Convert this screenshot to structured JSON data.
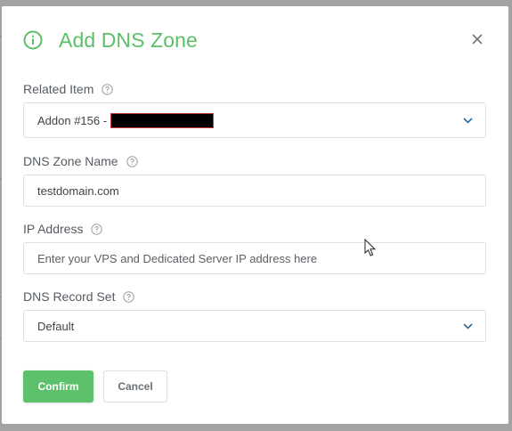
{
  "dialog": {
    "title": "Add DNS Zone",
    "colors": {
      "accent": "#5cbf68",
      "label": "#555b62",
      "border": "#dcdfe3"
    }
  },
  "fields": {
    "related_item": {
      "label": "Related Item",
      "value_prefix": "Addon #156 -"
    },
    "zone_name": {
      "label": "DNS Zone Name",
      "value": "testdomain.com"
    },
    "ip_address": {
      "label": "IP Address",
      "placeholder": "Enter your VPS and Dedicated Server IP address here"
    },
    "record_set": {
      "label": "DNS Record Set",
      "value": "Default"
    }
  },
  "buttons": {
    "confirm": "Confirm",
    "cancel": "Cancel"
  },
  "icons": {
    "header": "info-icon",
    "close": "close-icon",
    "help": "question-circle-icon",
    "dropdown": "chevron-down-icon"
  }
}
